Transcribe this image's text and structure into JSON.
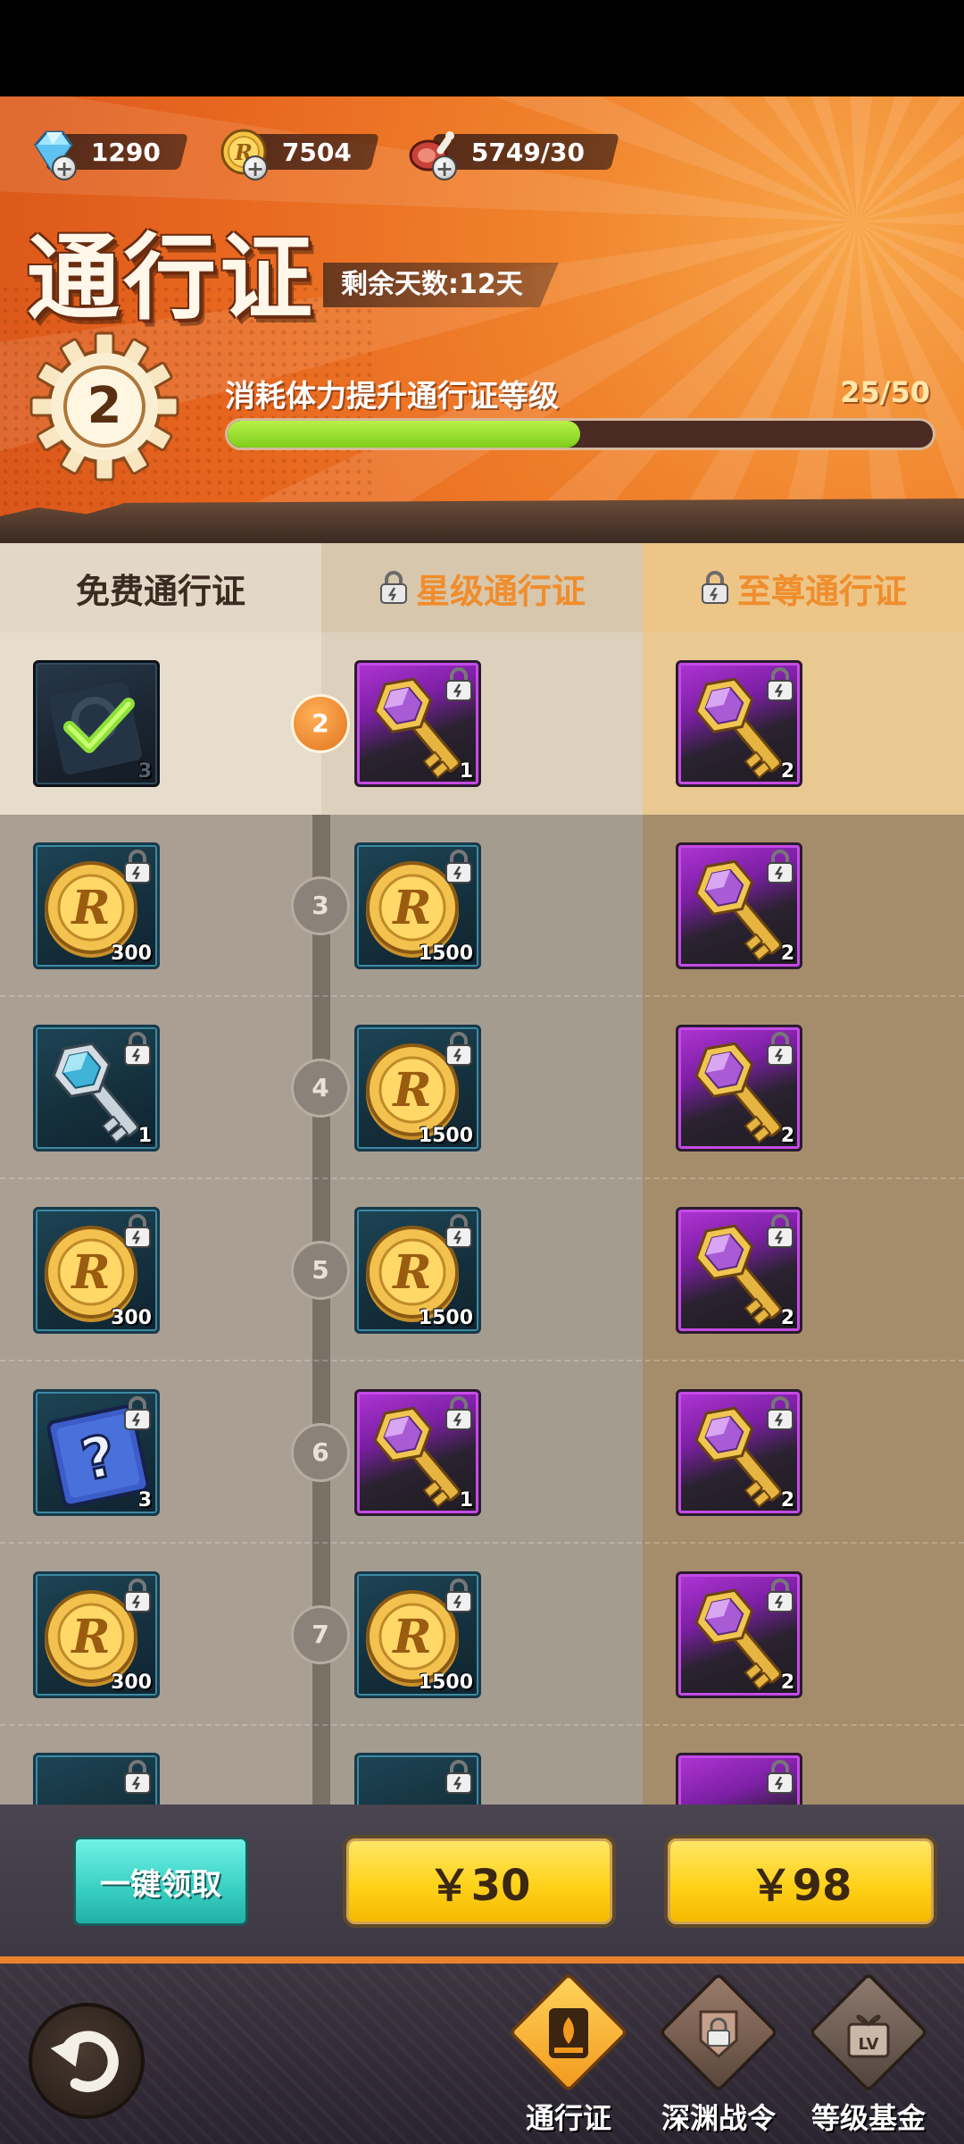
{
  "resources": [
    {
      "name": "diamond",
      "value": "1290",
      "icon": "diamond-icon"
    },
    {
      "name": "coin",
      "value": "7504",
      "icon": "r-coin-icon"
    },
    {
      "name": "stamina",
      "value": "5749/30",
      "icon": "meat-icon"
    }
  ],
  "header": {
    "title": "通行证",
    "days_left": "剩余天数:12天",
    "level": "2",
    "level_desc": "消耗体力提升通行证等级",
    "progress_text": "25/50",
    "progress": 0.5
  },
  "tabs": [
    {
      "label": "免费通行证"
    },
    {
      "label": "星级通行证"
    },
    {
      "label": "至尊通行证"
    }
  ],
  "rows": [
    {
      "level": "2",
      "free": {
        "type": "claimed",
        "qty": "3"
      },
      "star": {
        "type": "gold-key",
        "qty": "1"
      },
      "supreme": {
        "type": "gold-key",
        "qty": "2"
      }
    },
    {
      "level": "3",
      "free": {
        "type": "coin",
        "qty": "300"
      },
      "star": {
        "type": "coin",
        "qty": "1500"
      },
      "supreme": {
        "type": "gold-key",
        "qty": "2"
      }
    },
    {
      "level": "4",
      "free": {
        "type": "silver-key",
        "qty": "1"
      },
      "star": {
        "type": "coin",
        "qty": "1500"
      },
      "supreme": {
        "type": "gold-key",
        "qty": "2"
      }
    },
    {
      "level": "5",
      "free": {
        "type": "coin",
        "qty": "300"
      },
      "star": {
        "type": "coin",
        "qty": "1500"
      },
      "supreme": {
        "type": "gold-key",
        "qty": "2"
      }
    },
    {
      "level": "6",
      "free": {
        "type": "mystery-box",
        "qty": "3"
      },
      "star": {
        "type": "gold-key",
        "qty": "1"
      },
      "supreme": {
        "type": "gold-key",
        "qty": "2"
      }
    },
    {
      "level": "7",
      "free": {
        "type": "coin",
        "qty": "300"
      },
      "star": {
        "type": "coin",
        "qty": "1500"
      },
      "supreme": {
        "type": "gold-key",
        "qty": "2"
      }
    }
  ],
  "buttons": {
    "claim_all": "一键领取",
    "price_star": "￥30",
    "price_supreme": "￥98"
  },
  "nav": [
    {
      "label": "通行证",
      "icon": "pass-icon"
    },
    {
      "label": "深渊战令",
      "icon": "abyss-order-icon"
    },
    {
      "label": "等级基金",
      "icon": "level-fund-icon"
    }
  ],
  "colors": {
    "accent": "#f08d2c",
    "progress": "#8fd62a",
    "claim": "#38cfc2",
    "buy": "#ffd21a"
  }
}
